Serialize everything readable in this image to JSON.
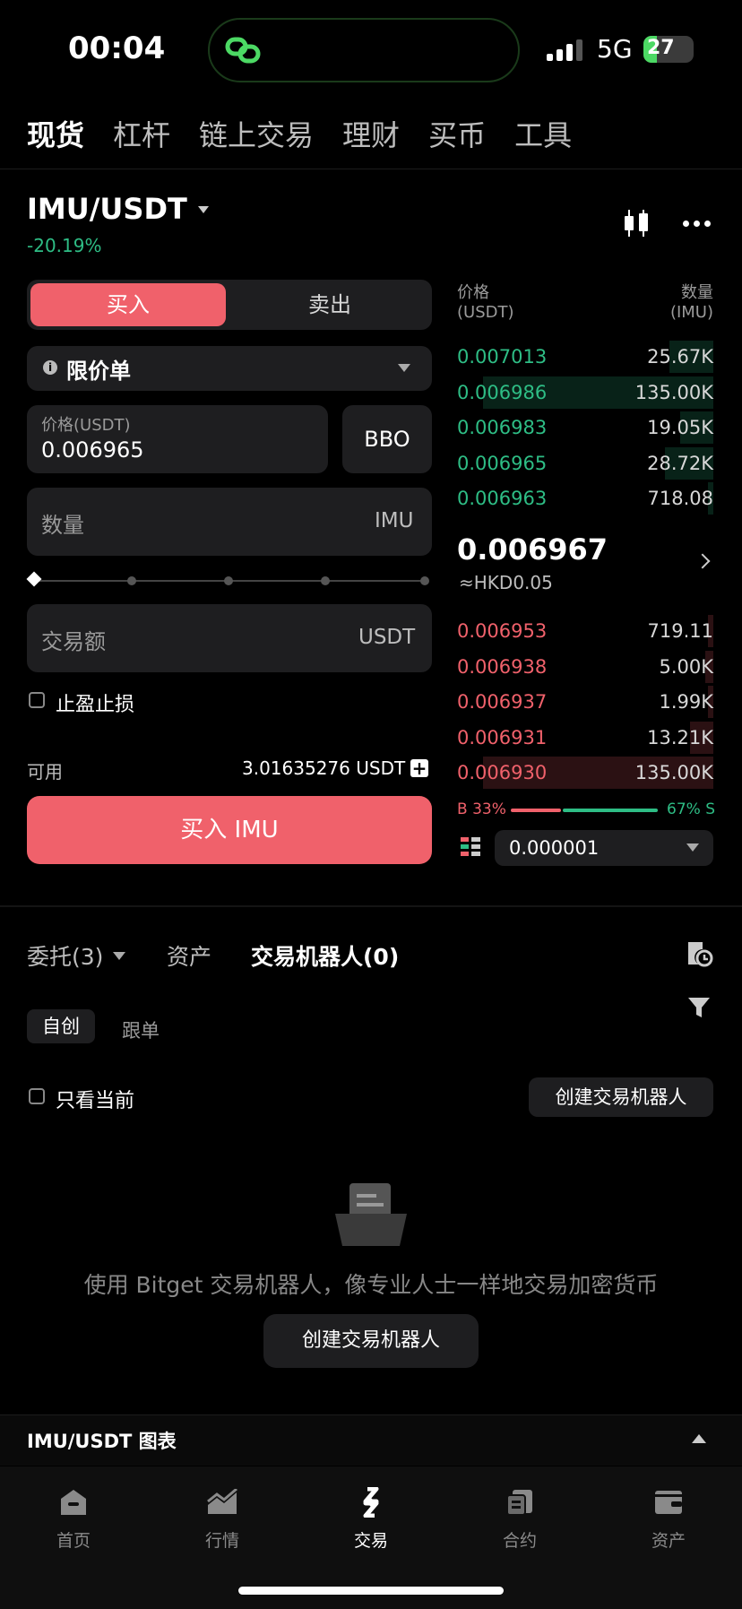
{
  "status_bar": {
    "time": "00:04",
    "network": "5G",
    "battery": "27"
  },
  "top_nav": [
    "现货",
    "杠杆",
    "链上交易",
    "理财",
    "买币",
    "工具"
  ],
  "market": {
    "pair": "IMU/USDT",
    "change": "-20.19%"
  },
  "order_form": {
    "buy_tab": "买入",
    "sell_tab": "卖出",
    "order_type": "限价单",
    "price_label": "价格(USDT)",
    "price_value": "0.006965",
    "bbo": "BBO",
    "qty_placeholder": "数量",
    "qty_unit": "IMU",
    "amount_placeholder": "交易额",
    "amount_unit": "USDT",
    "tpsl": "止盈止损",
    "available_label": "可用",
    "available_value": "3.01635276 USDT",
    "buy_button": "买入 IMU"
  },
  "order_book": {
    "price_header": "价格\n(USDT)",
    "qty_header": "数量\n(IMU)",
    "asks": [
      {
        "price": "0.007013",
        "qty": "25.67K",
        "depth": 0.17
      },
      {
        "price": "0.006986",
        "qty": "135.00K",
        "depth": 0.9
      },
      {
        "price": "0.006983",
        "qty": "19.05K",
        "depth": 0.13
      },
      {
        "price": "0.006965",
        "qty": "28.72K",
        "depth": 0.19
      },
      {
        "price": "0.006963",
        "qty": "718.08",
        "depth": 0.01
      }
    ],
    "last_price": "0.006967",
    "last_price_hkd": "≈HKD0.05",
    "bids": [
      {
        "price": "0.006953",
        "qty": "719.11",
        "depth": 0.01
      },
      {
        "price": "0.006938",
        "qty": "5.00K",
        "depth": 0.03
      },
      {
        "price": "0.006937",
        "qty": "1.99K",
        "depth": 0.02
      },
      {
        "price": "0.006931",
        "qty": "13.21K",
        "depth": 0.09
      },
      {
        "price": "0.006930",
        "qty": "135.00K",
        "depth": 0.9
      }
    ],
    "buy_ratio": "B 33%",
    "sell_ratio": "67% S",
    "precision": "0.000001"
  },
  "orders_panel": {
    "tab_orders": "委托(3)",
    "tab_assets": "资产",
    "tab_bots": "交易机器人(0)",
    "chip_own": "自创",
    "chip_copy": "跟单",
    "only_current": "只看当前",
    "create_bot_small": "创建交易机器人",
    "empty_text": "使用 Bitget 交易机器人，像专业人士一样地交易加密货币",
    "create_bot_big": "创建交易机器人"
  },
  "chart_section": {
    "label": "IMU/USDT 图表"
  },
  "bottom_nav": [
    "首页",
    "行情",
    "交易",
    "合约",
    "资产"
  ],
  "colors": {
    "buy": "#f0616b",
    "sell": "#2ebd85",
    "panel": "#1e1e20"
  }
}
